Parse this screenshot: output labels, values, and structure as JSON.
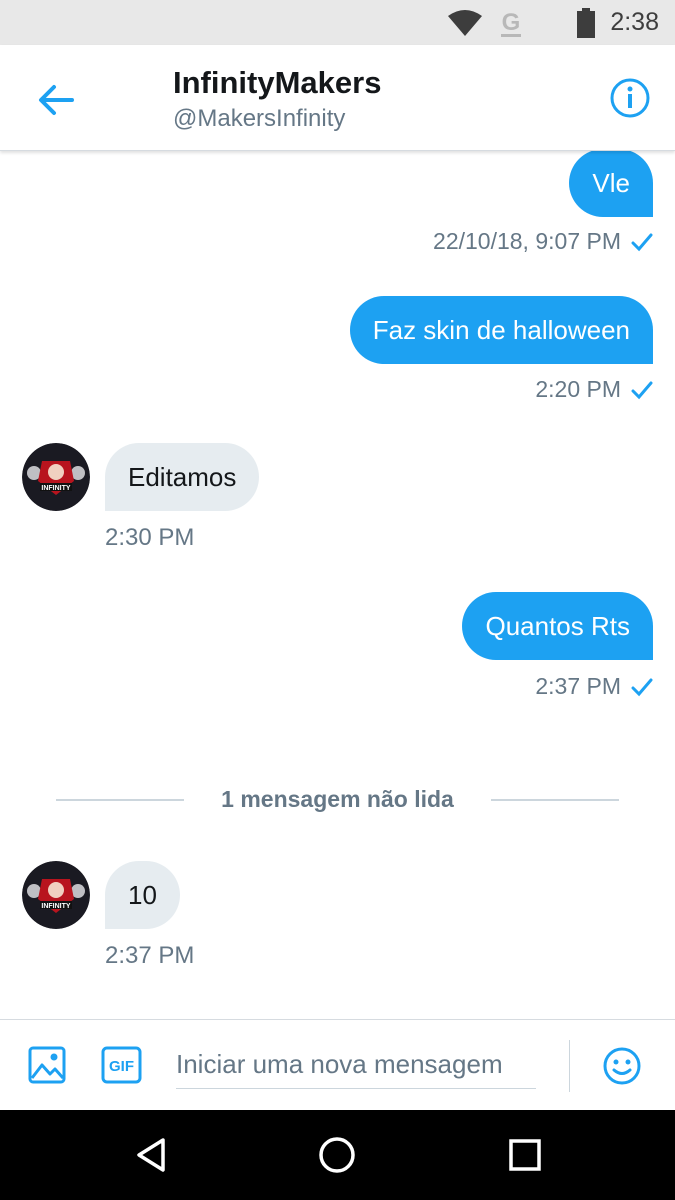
{
  "status_bar": {
    "time": "2:38",
    "icons": [
      "wifi-icon",
      "g-signal-icon",
      "battery-icon"
    ]
  },
  "header": {
    "title": "InfinityMakers",
    "handle": "@MakersInfinity",
    "back_icon": "back-arrow-icon",
    "info_icon": "info-icon"
  },
  "messages": [
    {
      "direction": "outgoing",
      "text": "Vle",
      "time": "22/10/18, 9:07 PM",
      "read": true
    },
    {
      "direction": "outgoing",
      "text": "Faz skin de halloween",
      "time": "2:20 PM",
      "read": true
    },
    {
      "direction": "incoming",
      "text": "Editamos",
      "time": "2:30 PM"
    },
    {
      "direction": "outgoing",
      "text": "Quantos Rts",
      "time": "2:37 PM",
      "read": true
    },
    {
      "direction": "incoming",
      "text": "10",
      "time": "2:37 PM"
    }
  ],
  "unread_divider": "1 mensagem não lida",
  "compose": {
    "placeholder": "Iniciar uma nova mensagem",
    "gif_label": "GIF",
    "icons": [
      "image-icon",
      "gif-icon",
      "emoji-icon"
    ]
  },
  "colors": {
    "accent": "#1da1f2",
    "incoming_bubble": "#e6ecf0",
    "secondary_text": "#657786",
    "status_bar": "#e8e8e8"
  }
}
